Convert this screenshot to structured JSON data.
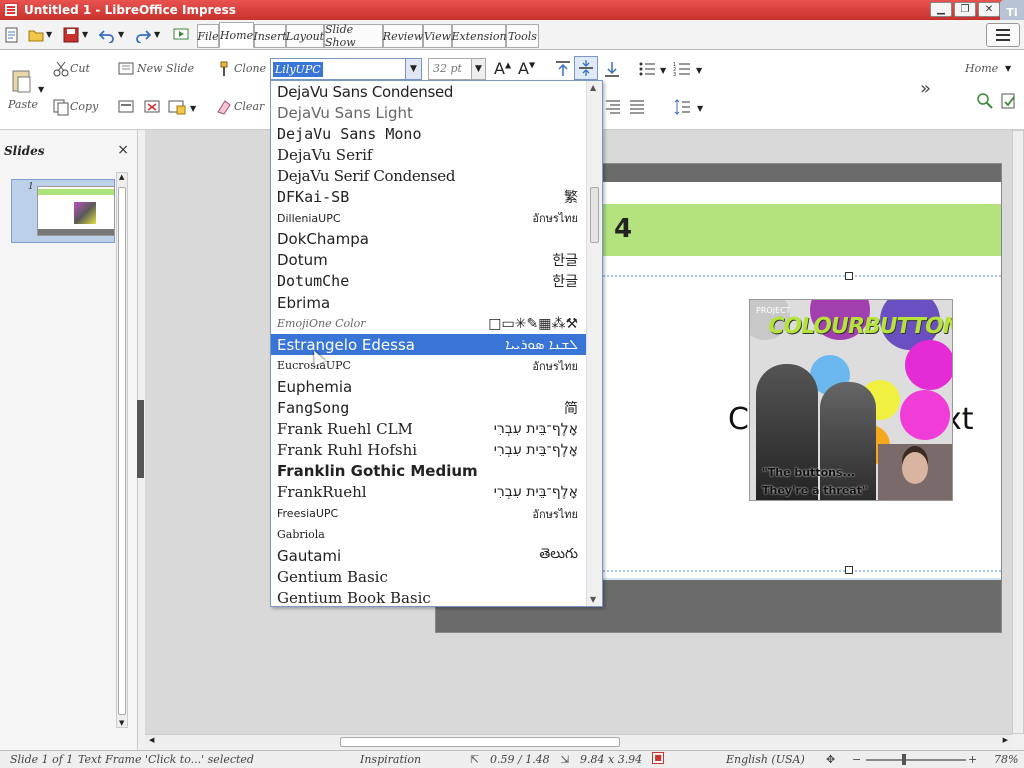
{
  "window": {
    "title": "Untitled 1 - LibreOffice Impress",
    "right_corner_label": "Ti"
  },
  "tabs": [
    {
      "label": "File",
      "active": false
    },
    {
      "label": "Home",
      "active": true
    },
    {
      "label": "Insert",
      "active": false
    },
    {
      "label": "Layout",
      "active": false
    },
    {
      "label": "Slide Show",
      "active": false
    },
    {
      "label": "Review",
      "active": false
    },
    {
      "label": "View",
      "active": false
    },
    {
      "label": "Extension",
      "active": false
    },
    {
      "label": "Tools",
      "active": false
    }
  ],
  "ribbon": {
    "paste": "Paste",
    "cut": "Cut",
    "copy": "Copy",
    "new_slide": "New Slide",
    "clone": "Clone",
    "clear": "Clear",
    "font_name": "LilyUPC",
    "font_size": "32 pt",
    "home": "Home",
    "overflow": "»"
  },
  "slides_pane": {
    "title": "Slides",
    "close": "×",
    "slide_number": "1"
  },
  "slide": {
    "title": "4",
    "body_left": "C",
    "body_right": "xt",
    "image": {
      "project": "PROJECT",
      "brand": "COLOURBUTTONS",
      "quote_line1": "\"The buttons...",
      "quote_line2": "They're a threat\""
    }
  },
  "font_list": {
    "selected": "Estrangelo Edessa",
    "items": [
      {
        "name": "DejaVu Sans Condensed",
        "sample": "",
        "font": "DejaVu Sans",
        "style": "condensed"
      },
      {
        "name": "DejaVu Sans Light",
        "sample": "",
        "font": "DejaVu Sans",
        "style": "light"
      },
      {
        "name": "DejaVu Sans Mono",
        "sample": "",
        "font": "DejaVu Sans Mono",
        "style": "normal"
      },
      {
        "name": "DejaVu Serif",
        "sample": "",
        "font": "DejaVu Serif",
        "style": "normal"
      },
      {
        "name": "DejaVu Serif Condensed",
        "sample": "",
        "font": "DejaVu Serif",
        "style": "condensed"
      },
      {
        "name": "DFKai-SB",
        "sample": "繁",
        "font": "DejaVu Sans Mono",
        "style": "normal"
      },
      {
        "name": "DilleniaUPC",
        "sample": "อักษรไทย",
        "font": "DejaVu Sans",
        "style": "small"
      },
      {
        "name": "DokChampa",
        "sample": "",
        "font": "DejaVu Sans",
        "style": "normal"
      },
      {
        "name": "Dotum",
        "sample": "한글",
        "font": "DejaVu Sans",
        "style": "normal"
      },
      {
        "name": "DotumChe",
        "sample": "한글",
        "font": "DejaVu Sans Mono",
        "style": "normal"
      },
      {
        "name": "Ebrima",
        "sample": "",
        "font": "DejaVu Sans",
        "style": "normal"
      },
      {
        "name": "EmojiOne Color",
        "sample": "□▭✳✎▦⁂⚒",
        "font": "DejaVu Serif",
        "style": "italic-small"
      },
      {
        "name": "Estrangelo Edessa",
        "sample": "ܠܫܢܐ ܣܘܪܝܝܐ",
        "font": "DejaVu Sans",
        "style": "normal"
      },
      {
        "name": "EucrosiaUPC",
        "sample": "อักษรไทย",
        "font": "DejaVu Serif",
        "style": "small"
      },
      {
        "name": "Euphemia",
        "sample": "",
        "font": "DejaVu Sans",
        "style": "normal"
      },
      {
        "name": "FangSong",
        "sample": "简",
        "font": "DejaVu Sans Mono",
        "style": "normal"
      },
      {
        "name": "Frank Ruehl CLM",
        "sample": "אָלֶף־בֵּית עִבְרִי",
        "font": "DejaVu Serif",
        "style": "normal"
      },
      {
        "name": "Frank Ruhl Hofshi",
        "sample": "אָלֶף־בֵּית עִבְרִי",
        "font": "DejaVu Serif",
        "style": "normal"
      },
      {
        "name": "Franklin Gothic Medium",
        "sample": "",
        "font": "DejaVu Sans",
        "style": "bold"
      },
      {
        "name": "FrankRuehl",
        "sample": "אָלֶף־בֵּית עִבְרִי",
        "font": "DejaVu Serif",
        "style": "normal"
      },
      {
        "name": "FreesiaUPC",
        "sample": "อักษรไทย",
        "font": "DejaVu Sans",
        "style": "small"
      },
      {
        "name": "Gabriola",
        "sample": "",
        "font": "DejaVu Serif",
        "style": "small"
      },
      {
        "name": "Gautami",
        "sample": "తెలుగు",
        "font": "DejaVu Sans",
        "style": "normal"
      },
      {
        "name": "Gentium Basic",
        "sample": "",
        "font": "DejaVu Serif",
        "style": "normal"
      },
      {
        "name": "Gentium Book Basic",
        "sample": "",
        "font": "DejaVu Serif",
        "style": "normal"
      }
    ]
  },
  "statusbar": {
    "slide": "Slide 1 of 1",
    "selection": "Text Frame 'Click to...' selected",
    "master": "Inspiration",
    "position": "0.59 / 1.48",
    "size": "9.84 x 3.94",
    "language": "English (USA)",
    "zoom": "78%",
    "zoom_minus": "−",
    "zoom_plus": "+"
  },
  "colors": {
    "accent": "#3875d7",
    "slide_title_bar": "#b4e27f",
    "slide_dark_bar": "#6b6b6b",
    "titlebar": "#d9433f"
  }
}
